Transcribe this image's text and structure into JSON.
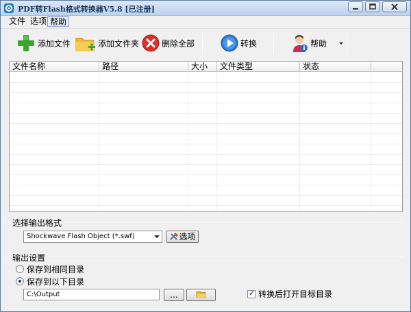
{
  "window": {
    "title": "PDF转Flash格式转换器V5.8    [已注册]"
  },
  "menu": {
    "file": "文件",
    "options": "选项",
    "help": "帮助"
  },
  "toolbar": {
    "add_file": "添加文件",
    "add_folder": "添加文件夹",
    "delete_all": "删除全部",
    "convert": "转换",
    "help": "帮助"
  },
  "file_list": {
    "columns": [
      "文件名称",
      "路径",
      "大小",
      "文件类型",
      "状态"
    ],
    "rows": []
  },
  "output_format": {
    "group_title": "选择输出格式",
    "selected": "Shockwave Flash Object (*.swf)",
    "options_button": "选项"
  },
  "output_settings": {
    "group_title": "输出设置",
    "radio_same_dir": "保存到相同目录",
    "radio_custom_dir": "保存到以下目录",
    "selected_radio": "radio_custom_dir",
    "path": "C:\\Output",
    "browse_button": "...",
    "open_after_convert": "转换后打开目标目录",
    "open_after_convert_checked": true
  },
  "icons": {
    "add_file": "plus-icon",
    "add_folder": "folder-add-icon",
    "delete_all": "delete-circle-icon",
    "convert": "play-circle-icon",
    "help": "help-person-icon",
    "dropdown": "chevron-down-icon",
    "options": "tools-icon",
    "browse_folder": "folder-icon"
  },
  "colors": {
    "titlebar": "#bcd3ee",
    "plus_green": "#3aa531",
    "delete_red": "#d9312a",
    "convert_blue": "#2c7ad6"
  }
}
